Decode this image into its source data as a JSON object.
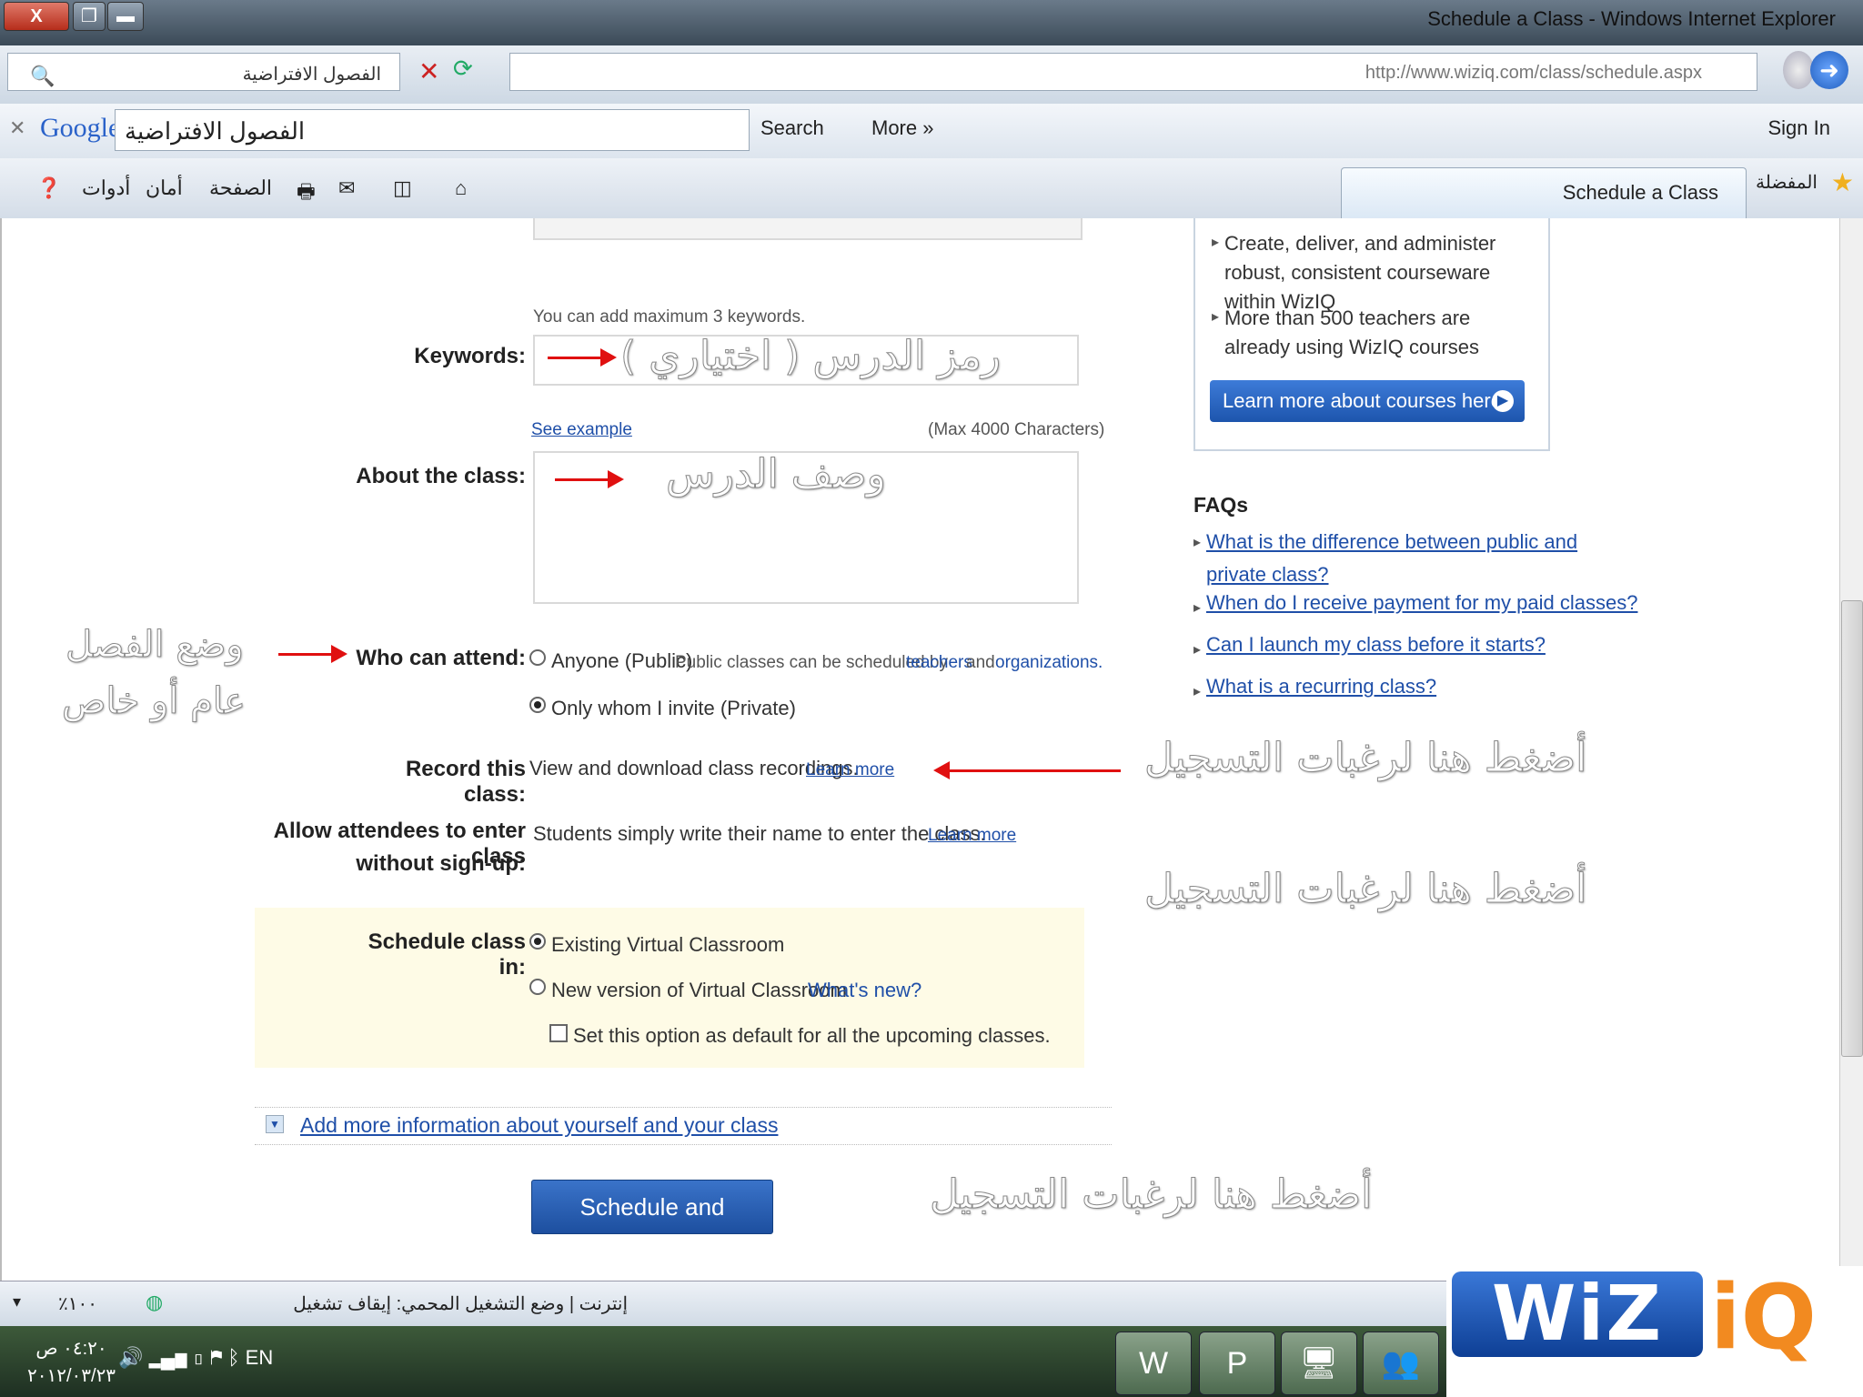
{
  "window": {
    "title": "Schedule a Class - Windows Internet Explorer",
    "close_label": "X"
  },
  "address_bar": {
    "search_text": "الفصول الافتراضية",
    "url": "http://www.wiziq.com/class/schedule.aspx"
  },
  "google_bar": {
    "logo": "Google",
    "query": "الفصول الافتراضية",
    "search_label": "Search",
    "more_label": "More »",
    "sign_in": "Sign In"
  },
  "command_bar": {
    "tools": "أدوات",
    "safety": "أمان",
    "page": "الصفحة",
    "tab_title": "Schedule a Class",
    "favorites": "المفضلة"
  },
  "form": {
    "keywords_hint": "You can add maximum 3 keywords.",
    "keywords_label": "Keywords:",
    "keywords_annotation": "رمز الدرس ( اختياري )",
    "see_example": "See example",
    "max_chars": "(Max 4000 Characters)",
    "about_label": "About the class:",
    "about_annotation": "وصف الدرس",
    "who_label": "Who can attend:",
    "who_public": "Anyone (Public)",
    "who_public_note": "Public classes can be scheduled by",
    "who_teachers": "teachers",
    "who_and": "and",
    "who_orgs": "organizations.",
    "who_private": "Only whom I invite (Private)",
    "who_annotation_1": "وضع الفصل",
    "who_annotation_2": "عام أو خاص",
    "record_label": "Record this class:",
    "record_text": "View and download class recordings.",
    "learn_more": "Learn more",
    "record_annotation": "أضغط هنا لرغبات التسجيل",
    "allow_label_1": "Allow attendees to enter class",
    "allow_label_2": "without sign-up:",
    "allow_text": "Students simply write their name to enter the class.",
    "allow_annotation": "أضغط هنا لرغبات التسجيل",
    "schedule_label": "Schedule class in:",
    "schedule_existing": "Existing Virtual Classroom",
    "schedule_new": "New version of Virtual Classroom",
    "whats_new": "What's new?",
    "set_default": "Set this option as default for all the upcoming classes.",
    "more_info": "Add more information about yourself and your class",
    "submit": "Schedule and Continue",
    "submit_annotation": "أضغط هنا لرغبات التسجيل"
  },
  "sidebar": {
    "bullets": [
      "Create, deliver, and administer robust, consistent courseware within WizIQ",
      "More than 500 teachers are already using WizIQ courses"
    ],
    "learn_button": "Learn more about courses here",
    "faqs_title": "FAQs",
    "faqs": [
      "What is the difference between public and private class?",
      "When do I receive payment for my paid classes?",
      "Can I launch my class before it starts?",
      "What is a recurring class?"
    ]
  },
  "status_bar": {
    "status": "إنترنت | وضع التشغيل المحمي: إيقاف تشغيل",
    "zoom": "١٠٠٪"
  },
  "taskbar": {
    "time": "٠٤:٢٠ ص",
    "date": "٢٠١٢/٠٣/٢٣",
    "lang": "EN"
  },
  "logo": {
    "wiz": "WiZ",
    "iq": "iQ"
  },
  "colors": {
    "link": "#1f4fa8",
    "button": "#1d55ad",
    "annotation_arrow": "#e01010",
    "schedule_panel": "#fefbe6"
  }
}
